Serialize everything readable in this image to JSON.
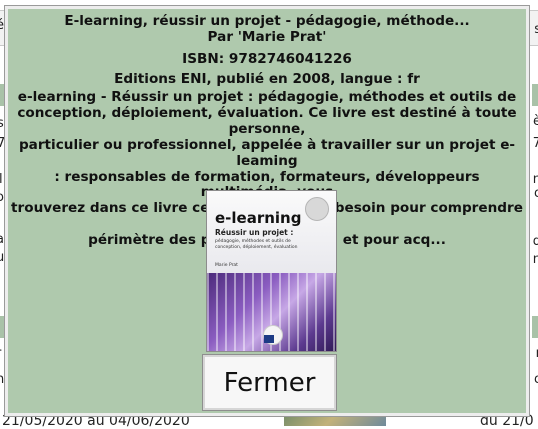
{
  "background": {
    "left_fragments": [
      "é",
      "s",
      "7",
      "l",
      "o",
      "a",
      "u",
      "r",
      "n"
    ],
    "right_fragments": [
      "s",
      "è",
      "7",
      "n",
      "o",
      "d",
      "n",
      "r",
      "o"
    ],
    "bottom_left_text": "21/05/2020 au 04/06/2020",
    "bottom_right_text": "du 21/0"
  },
  "modal": {
    "title": "E-learning, réussir un projet - pédagogie, méthode...",
    "author": "Par 'Marie Prat'",
    "isbn": "ISBN: 9782746041226",
    "publication": "Editions ENI, publié en 2008, langue : fr",
    "description_lines": [
      "e-learning - Réussir un projet : pédagogie, méthodes et outils de",
      "conception, déploiement, évaluation. Ce livre est destiné à toute personne,",
      "particulier ou professionnel, appelée à travailler sur un projet e-leaming",
      ": responsables de formation, formateurs, développeurs multimédia, vous",
      "trouverez dans ce livre ce dont vous avez besoin pour comprendre le",
      "périmètre des projets e-learning et pour acq..."
    ],
    "cover": {
      "title": "e-learning",
      "subtitle": "Réussir un projet :",
      "small_text": "pédagogie, méthodes et outils de conception, déploiement, évaluation",
      "author": "Marie Prat"
    },
    "close_label": "Fermer"
  }
}
